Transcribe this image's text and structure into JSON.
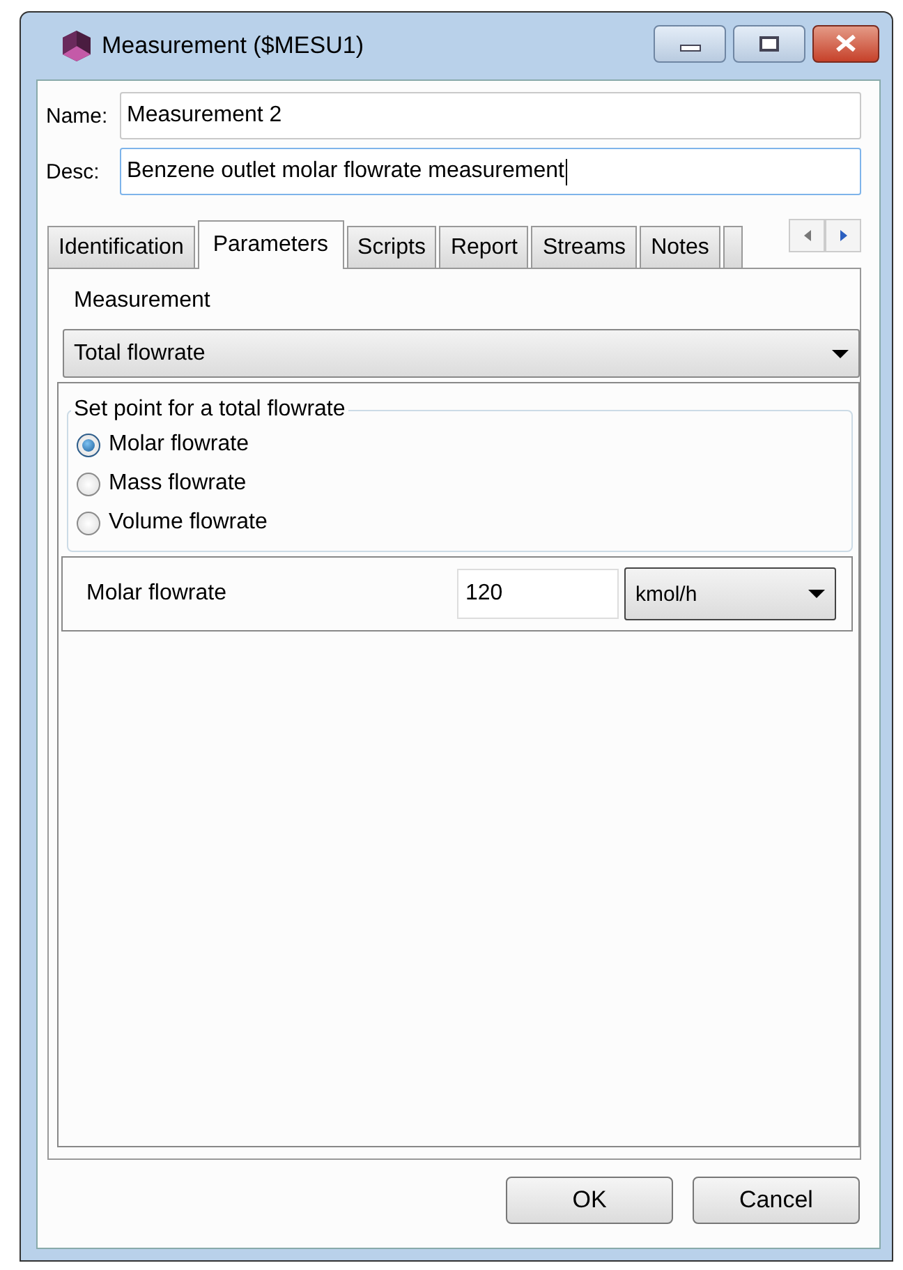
{
  "window": {
    "title": "Measurement ($MESU1)"
  },
  "fields": [
    {
      "label": "Name:",
      "value": "Measurement 2",
      "focused": false
    },
    {
      "label": "Desc:",
      "value": "Benzene outlet molar flowrate measurement",
      "focused": true
    }
  ],
  "tabs": [
    {
      "label": "Identification",
      "selected": false
    },
    {
      "label": "Parameters",
      "selected": true
    },
    {
      "label": "Scripts",
      "selected": false
    },
    {
      "label": "Report",
      "selected": false
    },
    {
      "label": "Streams",
      "selected": false
    },
    {
      "label": "Notes",
      "selected": false
    }
  ],
  "measurement": {
    "label": "Measurement",
    "value": "Total flowrate"
  },
  "setpoint": {
    "title": "Set point for a total flowrate",
    "options": [
      {
        "label": "Molar flowrate",
        "selected": true
      },
      {
        "label": "Mass flowrate",
        "selected": false
      },
      {
        "label": "Volume flowrate",
        "selected": false
      }
    ]
  },
  "flowrate": {
    "label": "Molar flowrate",
    "value": "120",
    "unit": "kmol/h"
  },
  "buttons": [
    "OK",
    "Cancel"
  ]
}
